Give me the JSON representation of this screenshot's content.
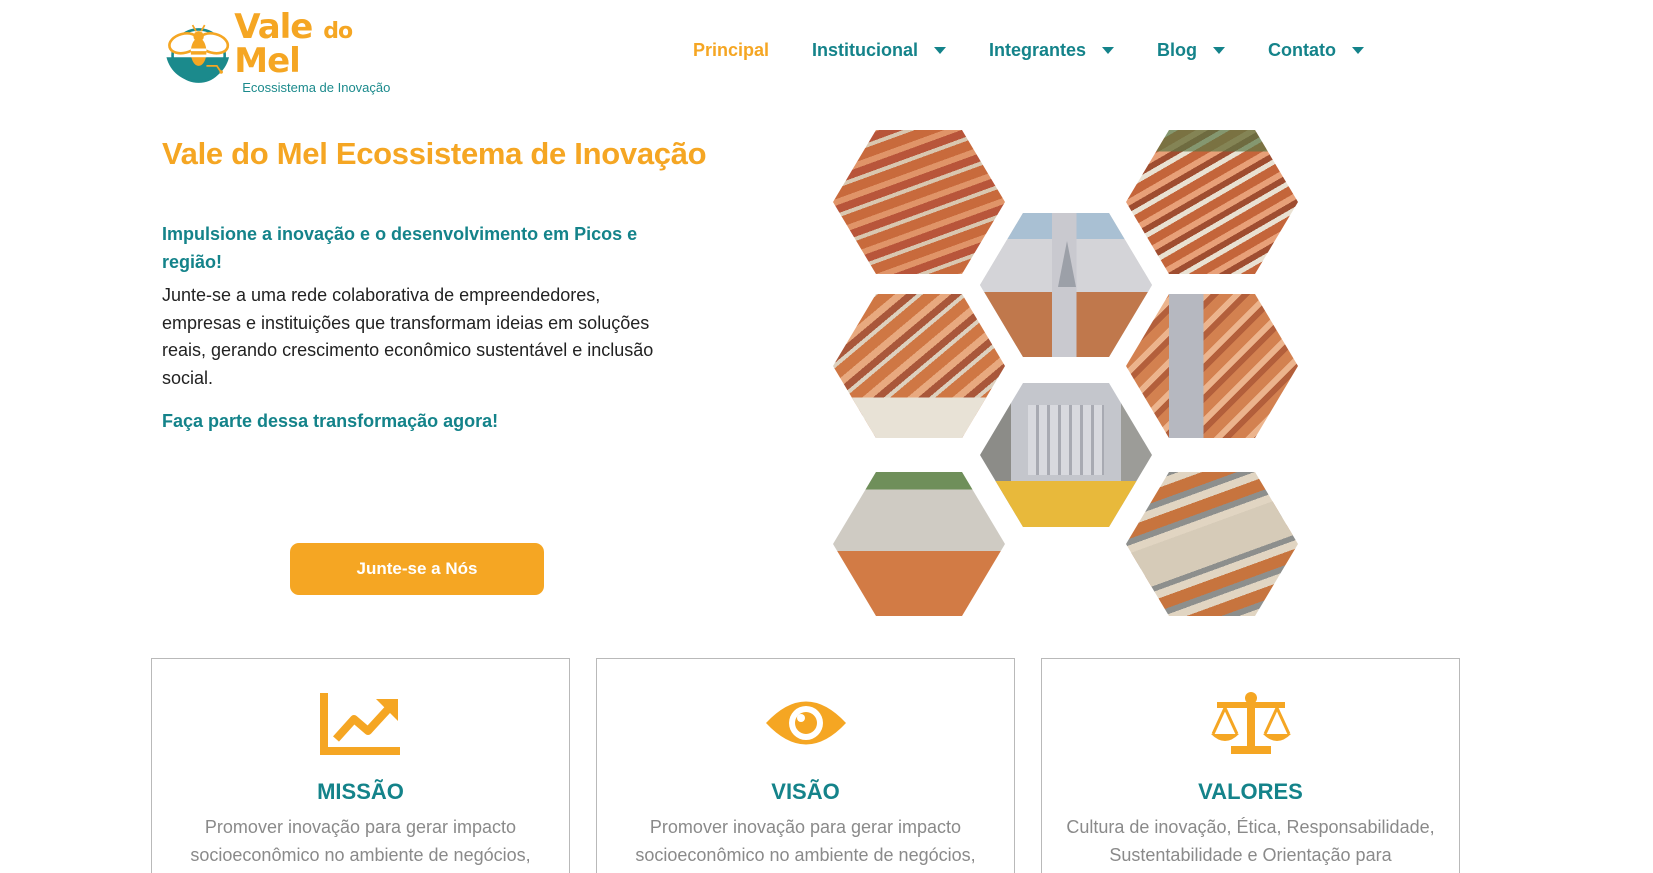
{
  "brand": {
    "name_part1": "Vale",
    "name_part2": "do",
    "name_part3": "Mel",
    "subtitle": "Ecossistema de Inovação",
    "logo_icon": "bee-icon"
  },
  "colors": {
    "accent": "#f5a623",
    "primary": "#14838a",
    "muted_text": "#8a8a8a"
  },
  "nav": {
    "items": [
      {
        "label": "Principal",
        "active": true,
        "has_dropdown": false
      },
      {
        "label": "Institucional",
        "active": false,
        "has_dropdown": true
      },
      {
        "label": "Integrantes",
        "active": false,
        "has_dropdown": true
      },
      {
        "label": "Blog",
        "active": false,
        "has_dropdown": true
      },
      {
        "label": "Contato",
        "active": false,
        "has_dropdown": true
      }
    ]
  },
  "hero": {
    "title": "Vale do Mel Ecossistema de Inovação",
    "tagline": "Impulsione a inovação e o desenvolvimento em Picos e região!",
    "body": "Junte-se a uma rede colaborativa de empreendedores, empresas e instituições que transformam ideias em soluções reais, gerando crescimento econômico sustentável e inclusão social.",
    "cta_text": "Faça parte dessa transformação agora!",
    "button_label": "Junte-se a Nós"
  },
  "cards": [
    {
      "icon": "chart-line-icon",
      "title": "MISSÃO",
      "text": "Promover inovação para gerar impacto socioeconômico no ambiente de negócios, através da conexão de empreendedores"
    },
    {
      "icon": "eye-icon",
      "title": "VISÃO",
      "text": "Promover inovação para gerar impacto socioeconômico no ambiente de negócios, através da conexão de empreendedores"
    },
    {
      "icon": "balance-scale-icon",
      "title": "VALORES",
      "text": "Cultura de inovação, Ética, Responsabilidade, Sustentabilidade e Orientação para Resultados"
    }
  ]
}
